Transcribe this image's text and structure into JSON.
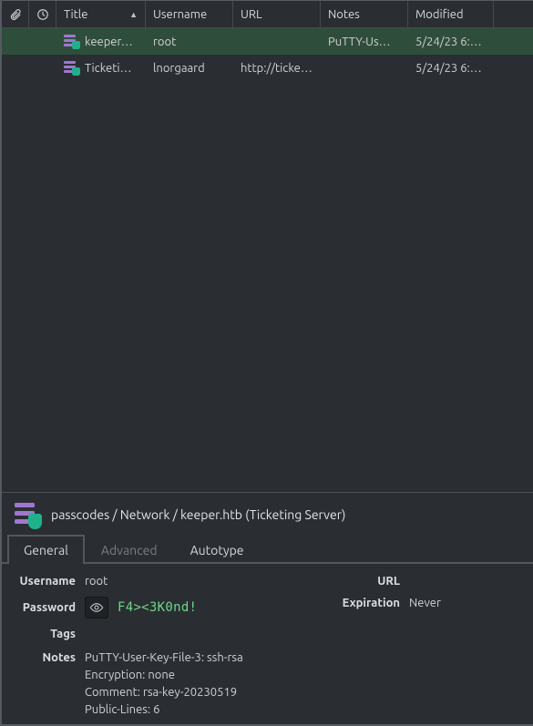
{
  "table": {
    "headers": {
      "title": "Title",
      "username": "Username",
      "url": "URL",
      "notes": "Notes",
      "modified": "Modified"
    },
    "rows": [
      {
        "title": "keeper.htb (Ticketing Server)",
        "title_display": "keeper…",
        "username": "root",
        "url": "",
        "notes": "PuTTY-User-Key-File-3: ssh-rsa",
        "notes_display": "PuTTY-Us…",
        "modified": "5/24/23 6:…",
        "selected": true
      },
      {
        "title": "Ticketing System",
        "title_display": "Ticketi…",
        "username": "lnorgaard",
        "url": "http://tickets.keeper.htb",
        "url_display": "http://ticke…",
        "notes": "",
        "modified": "5/24/23 6:…",
        "selected": false
      }
    ]
  },
  "detail": {
    "breadcrumb": "passcodes / Network / keeper.htb (Ticketing Server)",
    "tabs": {
      "general": "General",
      "advanced": "Advanced",
      "autotype": "Autotype"
    },
    "labels": {
      "username": "Username",
      "password": "Password",
      "tags": "Tags",
      "notes": "Notes",
      "url": "URL",
      "expiration": "Expiration"
    },
    "values": {
      "username": "root",
      "password": "F4><3K0nd!",
      "tags": "",
      "url": "",
      "expiration": "Never",
      "notes_lines": [
        "PuTTY-User-Key-File-3: ssh-rsa",
        "Encryption: none",
        "Comment: rsa-key-20230519",
        "Public-Lines: 6"
      ]
    }
  }
}
